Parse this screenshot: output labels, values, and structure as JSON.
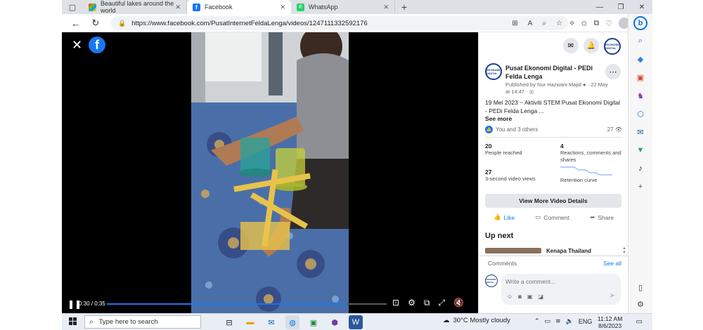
{
  "browser": {
    "tabs": [
      {
        "label": "Beautiful lakes around the world",
        "active": false,
        "icon": "msn-icon"
      },
      {
        "label": "Facebook",
        "active": true,
        "icon": "facebook-icon"
      },
      {
        "label": "WhatsApp",
        "active": false,
        "icon": "whatsapp-icon"
      }
    ],
    "tab_close_glyph": "✕",
    "new_tab_glyph": "+",
    "url": "https://www.facebook.com/PusatInternetFeldaLenga/videos/1247111332592176"
  },
  "video": {
    "time": "0:30 / 0:35",
    "progress_fraction": 0.857,
    "close_glyph": "✕",
    "logo_glyph": "f"
  },
  "post": {
    "page_name": "Pusat Ekonomi Digital - PEDi Felda Lenga",
    "avatar_text": "EKONOMI DIGITAL",
    "published_by": "Published by Nur Hazwani Majid ● · 22 May at 14:47 · ◎",
    "description": "19 Mei 2023 ~ Aktiviti STEM Pusat Ekonomi Digital - PEDi Felda Lenga ...",
    "see_more": "See more",
    "reactions_text": "You and 3 others",
    "views_count": "27 👁",
    "stats": {
      "people_reached_num": "20",
      "people_reached_lbl": "People reached",
      "reactions_num": "4",
      "reactions_lbl": "Reactions, comments and shares",
      "views_num": "27",
      "views_lbl": "3-second video views",
      "retention_lbl": "Retention curve"
    },
    "view_more_details": "View More Video Details",
    "actions": {
      "like": "Like",
      "comment": "Comment",
      "share": "Share"
    },
    "up_next": "Up next",
    "next_title": "Kenapa Thailand",
    "comments_label": "Comments",
    "see_all": "See all",
    "comment_placeholder": "Write a comment..."
  },
  "taskbar": {
    "search_placeholder": "Type here to search",
    "weather": "30°C  Mostly cloudy",
    "lang": "ENG",
    "time": "11:12 AM",
    "date": "8/6/2023"
  },
  "colors": {
    "facebook_blue": "#1877f2",
    "panel_bg": "#ffffff",
    "video_bg": "#000000"
  }
}
